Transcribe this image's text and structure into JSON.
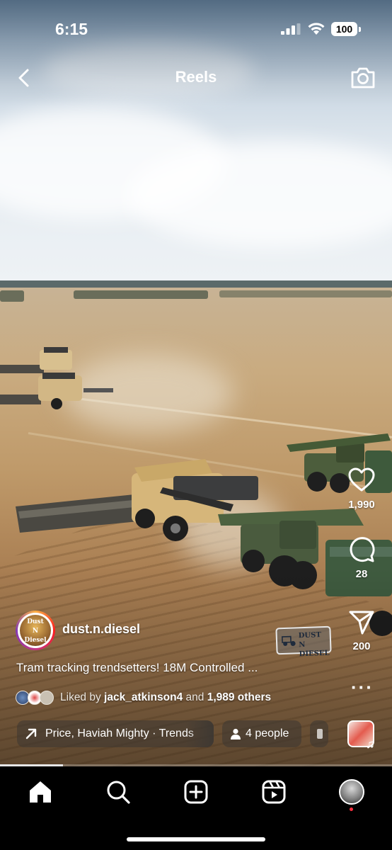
{
  "status_bar": {
    "time": "6:15",
    "battery": "100"
  },
  "header": {
    "title": "Reels"
  },
  "actions": {
    "likes": "1,990",
    "comments": "28",
    "shares": "200"
  },
  "post": {
    "username": "dust.n.diesel",
    "avatar_text": [
      "Dust",
      "N",
      "Diesel"
    ],
    "watermark_text": "DUST N DIESEL",
    "caption": "Tram tracking trendsetters! 18M Controlled ...",
    "liked_by_prefix": "Liked by",
    "liked_by_user": "jack_atkinson4",
    "liked_by_and": "and",
    "liked_by_others": "1,989 others"
  },
  "pills": {
    "audio": "Price, Haviah Mighty · Trends",
    "people": "4 people"
  },
  "video_progress": 0.16,
  "nav": {
    "items": [
      "home-icon",
      "search-icon",
      "create-icon",
      "reels-icon",
      "profile-avatar"
    ]
  },
  "colors": {
    "notification_dot": "#ff3040",
    "ring_start": "#fcb045",
    "ring_end": "#833ab4"
  }
}
